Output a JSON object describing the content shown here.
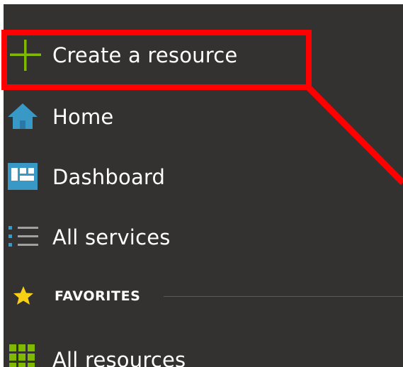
{
  "nav": {
    "items": [
      {
        "label": "Create a resource",
        "icon": "plus-icon"
      },
      {
        "label": "Home",
        "icon": "home-icon"
      },
      {
        "label": "Dashboard",
        "icon": "dashboard-icon"
      },
      {
        "label": "All services",
        "icon": "list-icon"
      }
    ]
  },
  "favorites": {
    "label": "FAVORITES",
    "icon": "star-icon",
    "items": [
      {
        "label": "All resources",
        "icon": "grid-icon"
      }
    ]
  },
  "annotation": {
    "color": "#ff0000",
    "target": "Create a resource"
  },
  "colors": {
    "panel_background": "#333231",
    "text": "#ffffff",
    "plus_green": "#7fba00",
    "home_blue": "#3999c6",
    "star_yellow": "#f8d117",
    "grid_green": "#7fba00"
  }
}
